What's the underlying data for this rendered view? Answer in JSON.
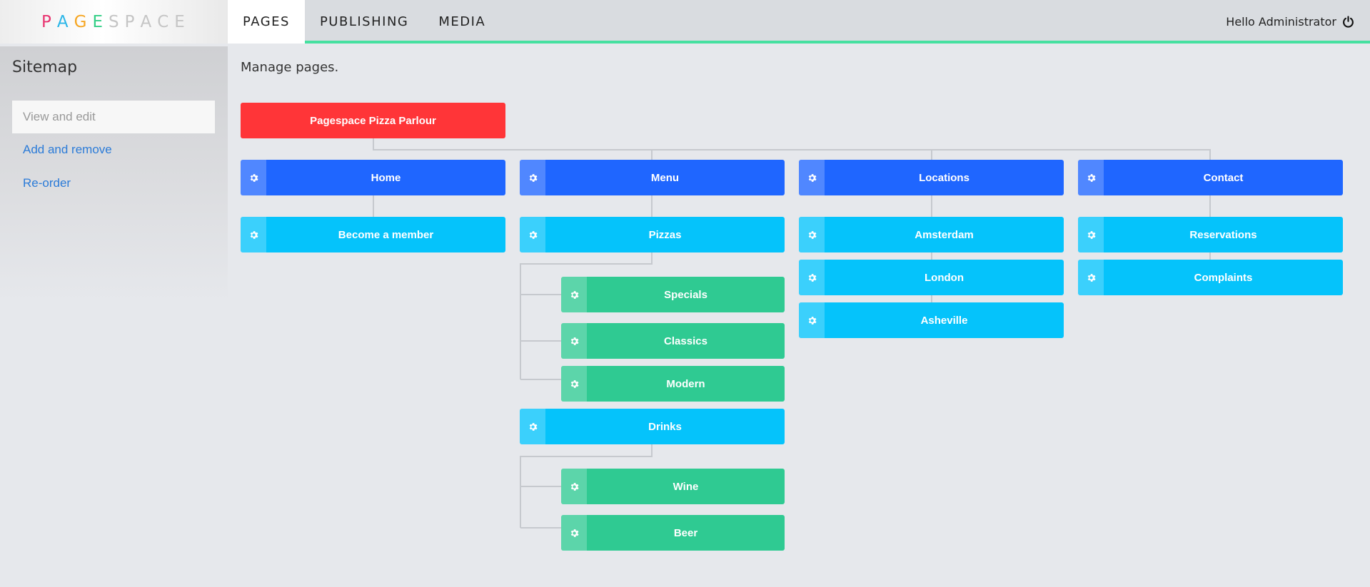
{
  "app": {
    "logo_letters": [
      {
        "char": "P",
        "color": "#e8336f"
      },
      {
        "char": "A",
        "color": "#2bb6e8"
      },
      {
        "char": "G",
        "color": "#f6a623"
      },
      {
        "char": "E",
        "color": "#33cf86"
      },
      {
        "char": "S",
        "color": "#c5c5c5"
      },
      {
        "char": "P",
        "color": "#c5c5c5"
      },
      {
        "char": "A",
        "color": "#c5c5c5"
      },
      {
        "char": "C",
        "color": "#c5c5c5"
      },
      {
        "char": "E",
        "color": "#c5c5c5"
      }
    ]
  },
  "nav": {
    "pages": "PAGES",
    "publishing": "PUBLISHING",
    "media": "MEDIA"
  },
  "user": {
    "greeting": "Hello Administrator",
    "icon": "power-icon"
  },
  "sidebar": {
    "title": "Sitemap",
    "active_item": "View and edit",
    "links": [
      "Add and remove",
      "Re-order"
    ]
  },
  "main": {
    "title": "Manage pages."
  },
  "colors": {
    "accent": "#46e0a0",
    "root": "#ff3538",
    "level1": "#1f66ff",
    "level2": "#05c3fb",
    "level3": "#2fca92",
    "link": "#2b7bd8"
  },
  "tree": {
    "root": "Pagespace Pizza Parlour",
    "sections": [
      {
        "label": "Home",
        "children": [
          {
            "label": "Become a member",
            "children": []
          }
        ]
      },
      {
        "label": "Menu",
        "children": [
          {
            "label": "Pizzas",
            "children": [
              {
                "label": "Specials"
              },
              {
                "label": "Classics"
              },
              {
                "label": "Modern"
              }
            ]
          },
          {
            "label": "Drinks",
            "children": [
              {
                "label": "Wine"
              },
              {
                "label": "Beer"
              }
            ]
          }
        ]
      },
      {
        "label": "Locations",
        "children": [
          {
            "label": "Amsterdam",
            "children": []
          },
          {
            "label": "London",
            "children": []
          },
          {
            "label": "Asheville",
            "children": []
          }
        ]
      },
      {
        "label": "Contact",
        "children": [
          {
            "label": "Reservations",
            "children": []
          },
          {
            "label": "Complaints",
            "children": []
          }
        ]
      }
    ]
  }
}
